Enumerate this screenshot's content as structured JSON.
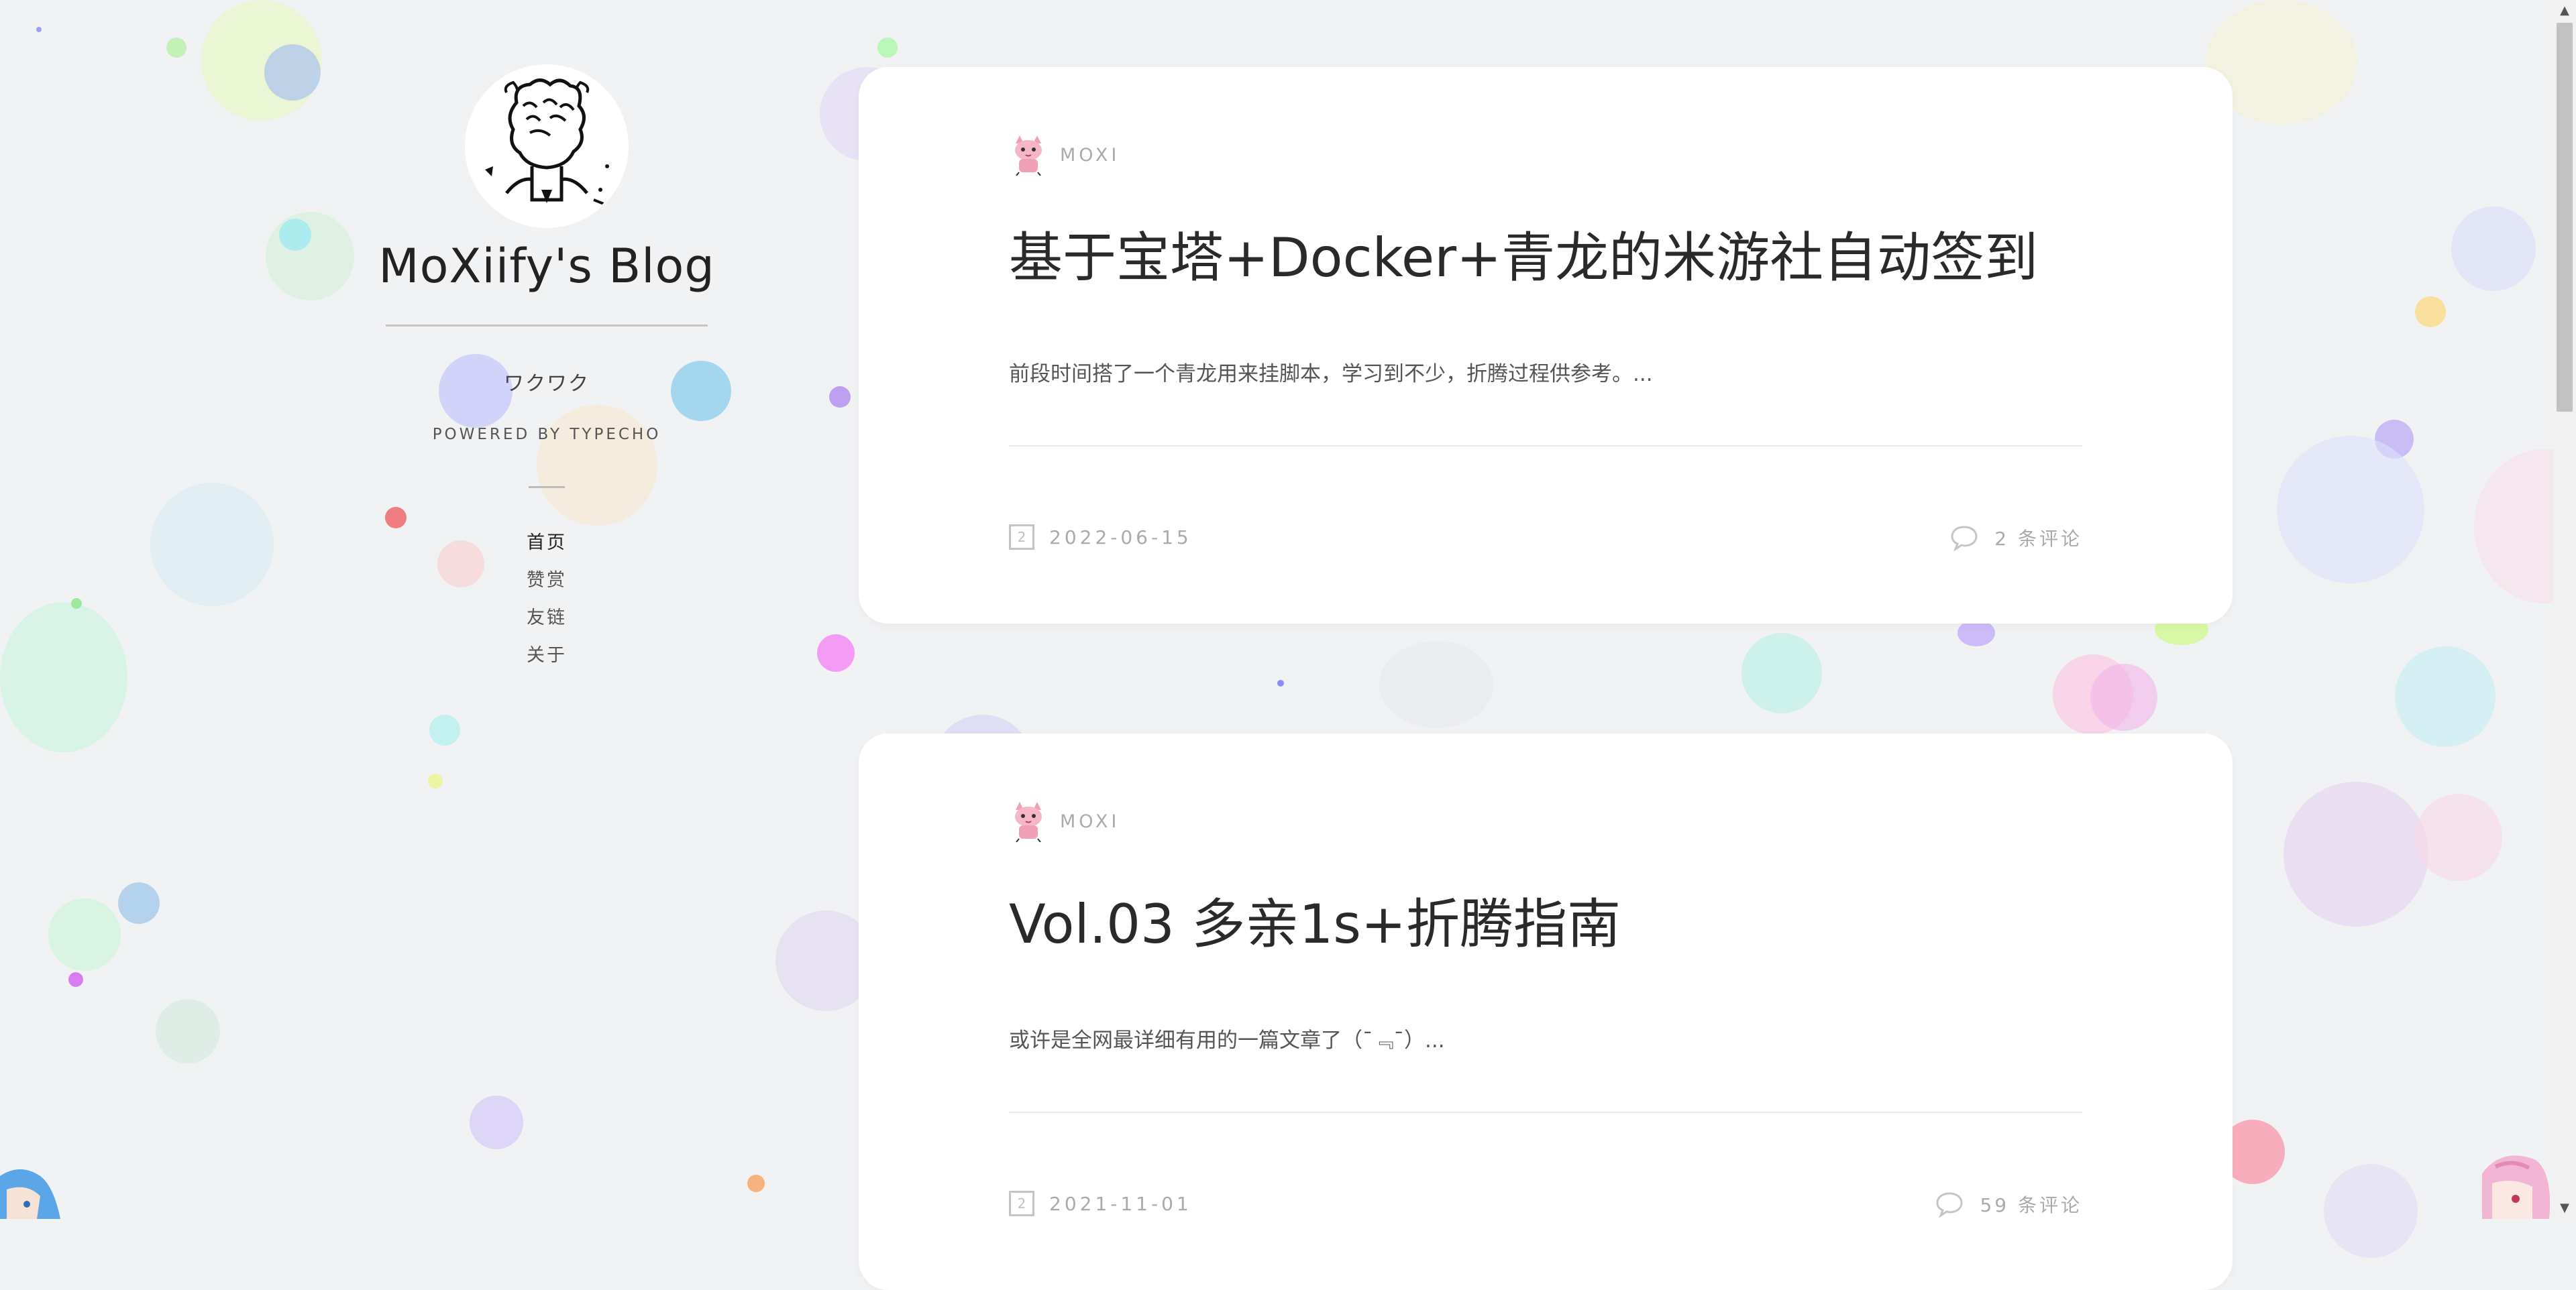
{
  "blog": {
    "title": "MoXiify's Blog",
    "tagline": "ワクワク",
    "powered_by": "POWERED BY TYPECHO"
  },
  "nav": {
    "items": [
      {
        "label": "首页"
      },
      {
        "label": "赞赏"
      },
      {
        "label": "友链"
      },
      {
        "label": "关于"
      }
    ]
  },
  "posts": [
    {
      "author": "MOXI",
      "title": "基于宝塔+Docker+青龙的米游社自动签到",
      "excerpt": "前段时间搭了一个青龙用来挂脚本，学习到不少，折腾过程供参考。...",
      "date_icon_num": "2",
      "date": "2022-06-15",
      "comments": "2 条评论"
    },
    {
      "author": "MOXI",
      "title": "Vol.03 多亲1s+折腾指南",
      "excerpt": "或许是全网最详细有用的一篇文章了（¯﹃¯）...",
      "date_icon_num": "2",
      "date": "2021-11-01",
      "comments": "59 条评论"
    }
  ],
  "colors": {
    "background": "#f1f2f4",
    "card": "#ffffff",
    "meta_text": "#aaaaaa"
  },
  "icons": {
    "avatar": "sketch-avatar",
    "author": "pink-cat-icon",
    "date": "calendar-icon",
    "comments": "comment-bubble-icon"
  }
}
